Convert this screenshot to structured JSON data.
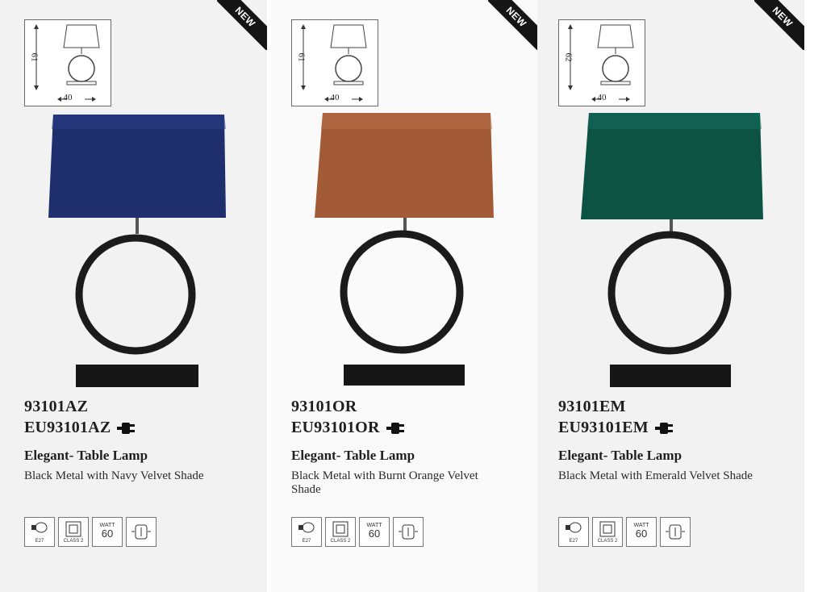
{
  "badge": "NEW",
  "products": [
    {
      "code": "93101AZ",
      "eu_code": "EU93101AZ",
      "name": "Elegant- Table Lamp",
      "description": "Black Metal with Navy Velvet Shade",
      "dims": {
        "height": "61",
        "width": "40"
      },
      "shade_color": "#1f2f6e",
      "icons": {
        "bulb": "E27",
        "class": "CLASS 2",
        "watt_label": "WATT",
        "watt_value": "60"
      }
    },
    {
      "code": "93101OR",
      "eu_code": "EU93101OR",
      "name": "Elegant- Table Lamp",
      "description": "Black Metal with Burnt Orange Velvet Shade",
      "dims": {
        "height": "61",
        "width": "40"
      },
      "shade_color": "#a35a36",
      "icons": {
        "bulb": "E27",
        "class": "CLASS 2",
        "watt_label": "WATT",
        "watt_value": "60"
      }
    },
    {
      "code": "93101EM",
      "eu_code": "EU93101EM",
      "name": "Elegant- Table Lamp",
      "description": "Black Metal with Emerald Velvet Shade",
      "dims": {
        "height": "62",
        "width": "40"
      },
      "shade_color": "#0c5344",
      "icons": {
        "bulb": "E27",
        "class": "CLASS 2",
        "watt_label": "WATT",
        "watt_value": "60"
      }
    }
  ]
}
